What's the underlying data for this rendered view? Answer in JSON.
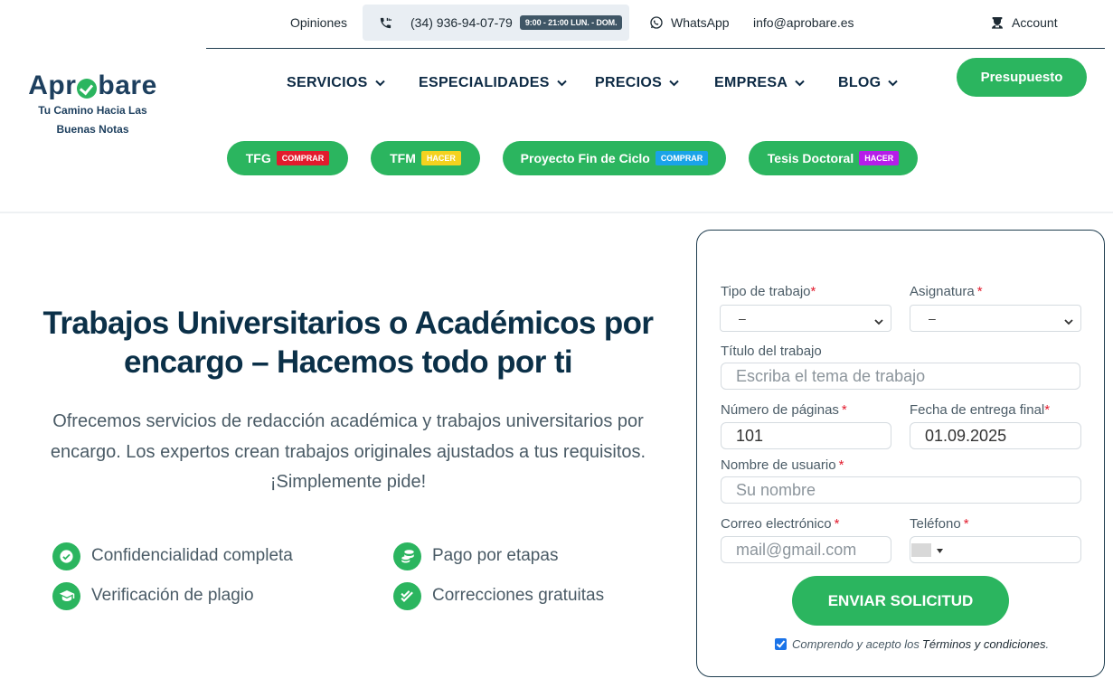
{
  "topbar": {
    "opinions": "Opiniones",
    "phone": "(34) 936-94-07-79",
    "hours": "9:00 - 21:00 LUN. - DOM.",
    "whatsapp": "WhatsApp",
    "email": "info@aprobare.es",
    "account": "Account"
  },
  "logo": {
    "part1": "Apr",
    "part2": "bare",
    "tagline_1": "Tu Camino Hacia Las",
    "tagline_2": "Buenas Notas"
  },
  "nav": {
    "items": [
      "SERVICIOS",
      "ESPECIALIDADES",
      "PRECIOS",
      "EMPRESA",
      "BLOG"
    ],
    "cta": "Presupuesto"
  },
  "pills": [
    {
      "label": "TFG",
      "tag": "COMPRAR",
      "tag_color": "#e21b2d"
    },
    {
      "label": "TFM",
      "tag": "HACER",
      "tag_color": "#f4d21f"
    },
    {
      "label": "Proyecto Fin de Ciclo",
      "tag": "COMPRAR",
      "tag_color": "#1aa3e8"
    },
    {
      "label": "Tesis Doctoral",
      "tag": "HACER",
      "tag_color": "#b51ee8"
    }
  ],
  "hero": {
    "title_line1": "Trabajos Universitarios o Académicos por",
    "title_line2": "encargo – Hacemos todo por ti",
    "subtitle_line1": "Ofrecemos servicios de redacción académica y trabajos universitarios por",
    "subtitle_line2": "encargo. Los expertos crean trabajos originales ajustados a tus requisitos.",
    "subtitle_line3": "¡Simplemente pide!"
  },
  "features": [
    {
      "label": "Confidencialidad completa",
      "icon": "check-circle-icon"
    },
    {
      "label": "Pago por etapas",
      "icon": "coins-icon"
    },
    {
      "label": "Verificación de plagio",
      "icon": "graduation-cap-icon"
    },
    {
      "label": "Correcciones gratuitas",
      "icon": "double-check-icon"
    }
  ],
  "form": {
    "tipo_label": "Tipo de trabajo",
    "tipo_value": "–",
    "asignatura_label": "Asignatura",
    "asignatura_value": "–",
    "titulo_label": "Título del trabajo",
    "titulo_placeholder": "Escriba el tema de trabajo",
    "paginas_label": "Número de páginas",
    "paginas_value": "101",
    "fecha_label": "Fecha de entrega final",
    "fecha_value": "01.09.2025",
    "usuario_label": "Nombre de usuario",
    "usuario_placeholder": "Su nombre",
    "correo_label": "Correo electrónico",
    "correo_placeholder": "mail@gmail.com",
    "telefono_label": "Teléfono",
    "required_mark": "*",
    "submit": "ENVIAR SOLICITUD",
    "terms_prefix": "Comprendo y acepto los",
    "terms_link": "Términos y condiciones",
    "terms_suffix": "."
  },
  "colors": {
    "brand_green": "#2bb55f",
    "navy": "#0b3048",
    "required_red": "#e21b2d"
  }
}
